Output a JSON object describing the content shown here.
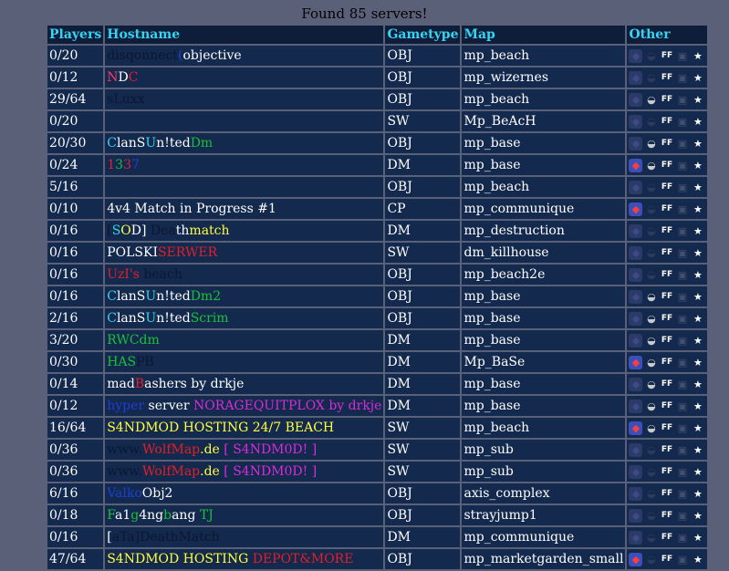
{
  "header_title": "Found 85 servers!",
  "columns": [
    "Players",
    "Hostname",
    "Gametype",
    "Map",
    "Other"
  ],
  "icon_names": [
    "punkbuster-icon",
    "helmet-icon",
    "friendly-fire-icon",
    "lock-icon",
    "runner-icon"
  ],
  "rows": [
    {
      "players": "0/20",
      "host": [
        {
          "t": "disqonnect",
          "c": "#0a1733"
        },
        {
          "t": "(",
          "c": "#1d3fd6"
        },
        {
          "t": "objective",
          "c": "#ffffff"
        }
      ],
      "gametype": "OBJ",
      "map": "mp_beach",
      "pb": false,
      "helmet": false
    },
    {
      "players": "0/12",
      "host": [
        {
          "t": "N",
          "c": "#ff3a6a"
        },
        {
          "t": "D",
          "c": "#ffffff"
        },
        {
          "t": "C",
          "c": "#e0202a"
        }
      ],
      "gametype": "OBJ",
      "map": "mp_wizernes",
      "pb": false,
      "helmet": false
    },
    {
      "players": "29/64",
      "host": [
        {
          "t": "sLuxx",
          "c": "#0a1733"
        }
      ],
      "gametype": "OBJ",
      "map": "mp_beach",
      "pb": false,
      "helmet": true
    },
    {
      "players": "0/20",
      "host": [],
      "gametype": "SW",
      "map": "Mp_BeAcH",
      "pb": false,
      "helmet": false
    },
    {
      "players": "20/30",
      "host": [
        {
          "t": "C",
          "c": "#35d4f2"
        },
        {
          "t": "lanS",
          "c": "#ffffff"
        },
        {
          "t": "U",
          "c": "#35d4f2"
        },
        {
          "t": "n!ted",
          "c": "#ffffff"
        },
        {
          "t": "Dm",
          "c": "#18c13a"
        }
      ],
      "gametype": "OBJ",
      "map": "mp_base",
      "pb": false,
      "helmet": true
    },
    {
      "players": "0/24",
      "host": [
        {
          "t": "1",
          "c": "#e0202a"
        },
        {
          "t": "3",
          "c": "#18c13a"
        },
        {
          "t": "3",
          "c": "#e0202a"
        },
        {
          "t": "7",
          "c": "#1d3fd6"
        }
      ],
      "gametype": "DM",
      "map": "mp_base",
      "pb": true,
      "helmet": true
    },
    {
      "players": "5/16",
      "host": [],
      "gametype": "OBJ",
      "map": "mp_beach",
      "pb": false,
      "helmet": false
    },
    {
      "players": "0/10",
      "host": [
        {
          "t": "4v4 Match in Progress #1",
          "c": "#ffffff"
        }
      ],
      "gametype": "CP",
      "map": "mp_communique",
      "pb": true,
      "helmet": false
    },
    {
      "players": "0/16",
      "host": [
        {
          "t": "[",
          "c": "#0a1733"
        },
        {
          "t": "S",
          "c": "#35d4f2"
        },
        {
          "t": "O",
          "c": "#ffff40"
        },
        {
          "t": "D] ",
          "c": "#ffffff"
        },
        {
          "t": "Dea",
          "c": "#0a1733"
        },
        {
          "t": "th",
          "c": "#ffffff"
        },
        {
          "t": "match",
          "c": "#ffff40"
        }
      ],
      "gametype": "DM",
      "map": "mp_destruction",
      "pb": false,
      "helmet": false
    },
    {
      "players": "0/16",
      "host": [
        {
          "t": "POLSKI",
          "c": "#ffffff"
        },
        {
          "t": "SERWER",
          "c": "#e0202a"
        }
      ],
      "gametype": "SW",
      "map": "dm_killhouse",
      "pb": false,
      "helmet": false
    },
    {
      "players": "0/16",
      "host": [
        {
          "t": "UzI's ",
          "c": "#e0202a"
        },
        {
          "t": "beach",
          "c": "#0a1733"
        }
      ],
      "gametype": "OBJ",
      "map": "mp_beach2e",
      "pb": false,
      "helmet": false
    },
    {
      "players": "0/16",
      "host": [
        {
          "t": "C",
          "c": "#35d4f2"
        },
        {
          "t": "lanS",
          "c": "#ffffff"
        },
        {
          "t": "U",
          "c": "#35d4f2"
        },
        {
          "t": "n!ted",
          "c": "#ffffff"
        },
        {
          "t": "Dm2",
          "c": "#18c13a"
        }
      ],
      "gametype": "OBJ",
      "map": "mp_base",
      "pb": false,
      "helmet": true
    },
    {
      "players": "2/16",
      "host": [
        {
          "t": "C",
          "c": "#35d4f2"
        },
        {
          "t": "lanS",
          "c": "#ffffff"
        },
        {
          "t": "U",
          "c": "#35d4f2"
        },
        {
          "t": "n!ted",
          "c": "#ffffff"
        },
        {
          "t": "Scrim",
          "c": "#18c13a"
        }
      ],
      "gametype": "OBJ",
      "map": "mp_base",
      "pb": false,
      "helmet": true
    },
    {
      "players": "3/20",
      "host": [
        {
          "t": "RWCdm",
          "c": "#18c13a"
        }
      ],
      "gametype": "DM",
      "map": "mp_base",
      "pb": false,
      "helmet": true
    },
    {
      "players": "0/30",
      "host": [
        {
          "t": "HAS",
          "c": "#18c13a"
        },
        {
          "t": "PB",
          "c": "#0a1733"
        }
      ],
      "gametype": "DM",
      "map": "Mp_BaSe",
      "pb": true,
      "helmet": true
    },
    {
      "players": "0/14",
      "host": [
        {
          "t": "mad",
          "c": "#ffffff"
        },
        {
          "t": "B",
          "c": "#e0202a"
        },
        {
          "t": "ashers by drkje",
          "c": "#ffffff"
        }
      ],
      "gametype": "DM",
      "map": "mp_base",
      "pb": false,
      "helmet": true
    },
    {
      "players": "0/12",
      "host": [
        {
          "t": "hyper ",
          "c": "#1d3fd6"
        },
        {
          "t": "server ",
          "c": "#ffffff"
        },
        {
          "t": "NORAGEQUITPLOX by drkje",
          "c": "#d82cd8"
        }
      ],
      "gametype": "DM",
      "map": "mp_base",
      "pb": false,
      "helmet": true
    },
    {
      "players": "16/64",
      "host": [
        {
          "t": "S4NDMOD HOSTING 24/7 BEACH",
          "c": "#ffff40"
        }
      ],
      "gametype": "SW",
      "map": "mp_beach",
      "pb": true,
      "helmet": true
    },
    {
      "players": "0/36",
      "host": [
        {
          "t": "www.",
          "c": "#0a1733"
        },
        {
          "t": "WolfMap",
          "c": "#e0202a"
        },
        {
          "t": ".de ",
          "c": "#ffff40"
        },
        {
          "t": "[ S4NDM0D! ]",
          "c": "#d82cd8"
        }
      ],
      "gametype": "SW",
      "map": "mp_sub",
      "pb": false,
      "helmet": false
    },
    {
      "players": "0/36",
      "host": [
        {
          "t": "www.",
          "c": "#0a1733"
        },
        {
          "t": "WolfMap",
          "c": "#e0202a"
        },
        {
          "t": ".de ",
          "c": "#ffff40"
        },
        {
          "t": "[ S4NDM0D! ]",
          "c": "#d82cd8"
        }
      ],
      "gametype": "SW",
      "map": "mp_sub",
      "pb": false,
      "helmet": false
    },
    {
      "players": "6/16",
      "host": [
        {
          "t": "Valko",
          "c": "#1d3fd6"
        },
        {
          "t": "Obj2",
          "c": "#ffffff"
        }
      ],
      "gametype": "OBJ",
      "map": "axis_complex",
      "pb": false,
      "helmet": false
    },
    {
      "players": "0/18",
      "host": [
        {
          "t": "F",
          "c": "#18c13a"
        },
        {
          "t": "a1",
          "c": "#ffffff"
        },
        {
          "t": "g",
          "c": "#18c13a"
        },
        {
          "t": "4ng",
          "c": "#ffffff"
        },
        {
          "t": "b",
          "c": "#18c13a"
        },
        {
          "t": "ang ",
          "c": "#ffffff"
        },
        {
          "t": "TJ",
          "c": "#18c13a"
        }
      ],
      "gametype": "OBJ",
      "map": "strayjump1",
      "pb": false,
      "helmet": false
    },
    {
      "players": "0/16",
      "host": [
        {
          "t": "[",
          "c": "#ffffff"
        },
        {
          "t": "aTa]",
          "c": "#0a1733"
        },
        {
          "t": "DeathMatch",
          "c": "#0a1733"
        }
      ],
      "gametype": "DM",
      "map": "mp_communique",
      "pb": false,
      "helmet": false
    },
    {
      "players": "47/64",
      "host": [
        {
          "t": "S4NDMOD HOSTING ",
          "c": "#ffff40"
        },
        {
          "t": "DEPOT&MORE",
          "c": "#e0202a"
        }
      ],
      "gametype": "OBJ",
      "map": "mp_marketgarden_small",
      "pb": true,
      "helmet": false
    }
  ]
}
